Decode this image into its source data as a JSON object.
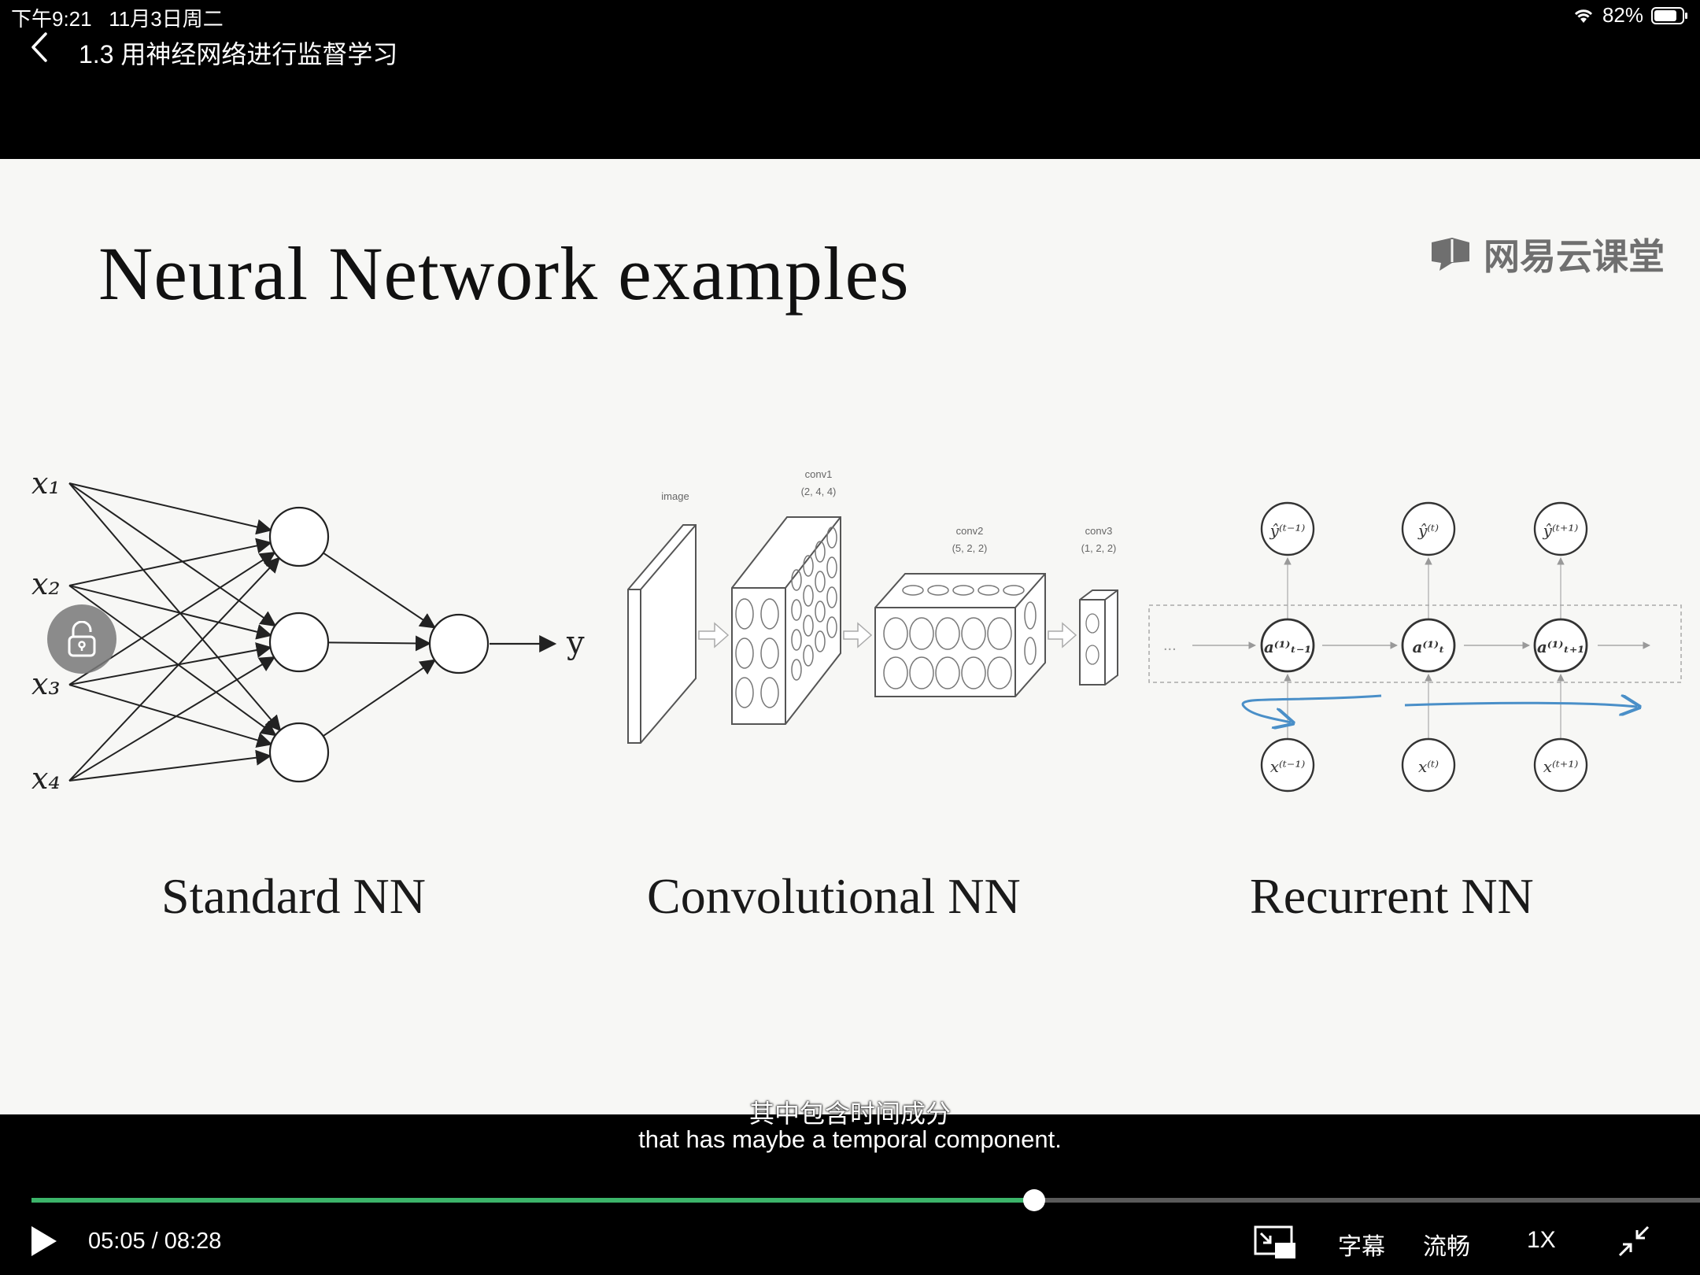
{
  "status_bar": {
    "time": "下午9:21",
    "date": "11月3日周二",
    "battery": "82%"
  },
  "header": {
    "title": "1.3 用神经网络进行监督学习"
  },
  "slide": {
    "title": "Neural Network examples",
    "brand": "网易云课堂",
    "labels": {
      "standard": "Standard NN",
      "convolutional": "Convolutional NN",
      "recurrent": "Recurrent NN"
    },
    "standard_nn": {
      "inputs": [
        "x₁",
        "x₂",
        "x₃",
        "x₄"
      ],
      "output": "y"
    },
    "cnn": {
      "image_label": "image",
      "conv1": [
        "conv1",
        "(2, 4, 4)"
      ],
      "conv2": [
        "conv2",
        "(5, 2, 2)"
      ],
      "conv3": [
        "conv3",
        "(1, 2, 2)"
      ]
    },
    "rnn": {
      "outputs": [
        "ŷ⁽ᵗ⁻¹⁾",
        "ŷ⁽ᵗ⁾",
        "ŷ⁽ᵗ⁺¹⁾"
      ],
      "hidden": [
        "a⁽¹⁾ₜ₋₁",
        "a⁽¹⁾ₜ",
        "a⁽¹⁾ₜ₊₁"
      ],
      "inputs": [
        "x⁽ᵗ⁻¹⁾",
        "x⁽ᵗ⁾",
        "x⁽ᵗ⁺¹⁾"
      ],
      "ellipsis": "..."
    }
  },
  "subtitles": {
    "chinese": "其中包含时间成分",
    "english": "that has maybe a temporal component."
  },
  "player": {
    "current_time": "05:05",
    "separator": " / ",
    "total_time": "08:28",
    "progress_fraction": 0.601,
    "accent_color": "#3cb46a",
    "subtitle_label": "字幕",
    "quality_label": "流畅",
    "speed_label": "1X"
  }
}
